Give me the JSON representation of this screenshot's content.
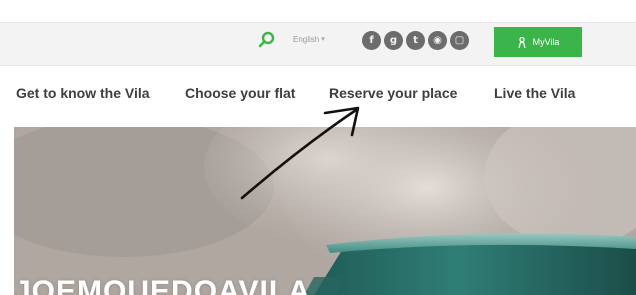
{
  "header": {
    "language_label": "English",
    "myvila_label": "MyVila",
    "social_icons": [
      "facebook-icon",
      "googleplus-icon",
      "twitter-icon",
      "foursquare-icon",
      "instagram-icon"
    ],
    "accent_color": "#3bb54a"
  },
  "nav": {
    "items": [
      {
        "label": "Get to know the Vila"
      },
      {
        "label": "Choose your flat"
      },
      {
        "label": "Reserve your place"
      },
      {
        "label": "Live the Vila"
      }
    ]
  },
  "hero": {
    "title": "JOEMQUEDOAVILA"
  }
}
